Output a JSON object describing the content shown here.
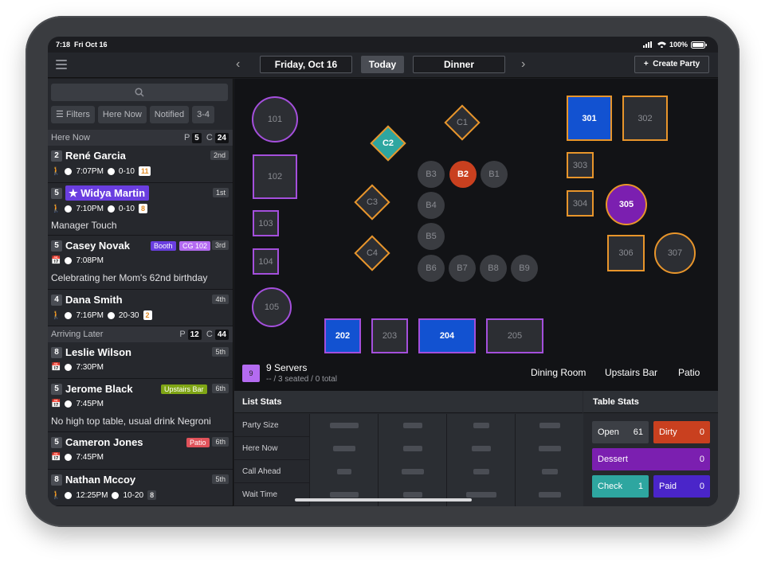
{
  "status_bar": {
    "time": "7:18",
    "date": "Fri Oct 16",
    "battery": "100%"
  },
  "topbar": {
    "date": "Friday, Oct 16",
    "today": "Today",
    "shift": "Dinner",
    "create": "Create Party"
  },
  "sidebar": {
    "chips": [
      "Filters",
      "Here Now",
      "Notified",
      "3-4"
    ],
    "here_now": {
      "label": "Here Now",
      "p_label": "P",
      "p": "5",
      "c_label": "C",
      "c": "24"
    },
    "arriving_later": {
      "label": "Arriving Later",
      "p_label": "P",
      "p": "12",
      "c_label": "C",
      "c": "44"
    },
    "parties": [
      {
        "size": "2",
        "name": "René Garcia",
        "rank": "2nd",
        "time": "7:07PM",
        "wait": "0-10",
        "wait_num": "11"
      },
      {
        "size": "5",
        "name": "Widya Martin",
        "rank": "1st",
        "time": "7:10PM",
        "wait": "0-10",
        "wait_num": "8",
        "note": "Manager Touch"
      },
      {
        "size": "5",
        "name": "Casey Novak",
        "rank": "3rd",
        "tag1": "Booth",
        "tag2": "CG 102",
        "time": "7:08PM",
        "note": "Celebrating her Mom's 62nd birthday"
      },
      {
        "size": "4",
        "name": "Dana Smith",
        "rank": "4th",
        "time": "7:16PM",
        "wait": "20-30",
        "wait_num": "2"
      },
      {
        "size": "8",
        "name": "Leslie Wilson",
        "rank": "5th",
        "time": "7:30PM"
      },
      {
        "size": "5",
        "name": "Jerome Black",
        "rank": "6th",
        "tag1": "Upstairs Bar",
        "time": "7:45PM",
        "note": "No high top table, usual drink Negroni"
      },
      {
        "size": "5",
        "name": "Cameron Jones",
        "rank": "6th",
        "tag1": "Patio",
        "time": "7:45PM"
      },
      {
        "size": "8",
        "name": "Nathan Mccoy",
        "rank": "5th",
        "time": "12:25PM",
        "wait": "10-20",
        "wait_num": "8"
      }
    ]
  },
  "floor": {
    "tables": {
      "t101": "101",
      "t102": "102",
      "t103": "103",
      "t104": "104",
      "t105": "105",
      "c1": "C1",
      "c2": "C2",
      "c3": "C3",
      "c4": "C4",
      "b1": "B1",
      "b2": "B2",
      "b3": "B3",
      "b4": "B4",
      "b5": "B5",
      "b6": "B6",
      "b7": "B7",
      "b8": "B8",
      "b9": "B9",
      "t202": "202",
      "t203": "203",
      "t204": "204",
      "t205": "205",
      "t301": "301",
      "t302": "302",
      "t303": "303",
      "t304": "304",
      "t305": "305",
      "t306": "306",
      "t307": "307"
    },
    "servers": {
      "badge": "9",
      "title": "9 Servers",
      "subtitle": "-- / 3 seated / 0 total"
    },
    "rooms": [
      "Dining Room",
      "Upstairs Bar",
      "Patio"
    ]
  },
  "list_stats": {
    "title": "List Stats",
    "rows": [
      "Party Size",
      "Here Now",
      "Call Ahead",
      "Wait Time"
    ]
  },
  "table_stats": {
    "title": "Table Stats",
    "open": {
      "label": "Open",
      "value": "61"
    },
    "dirty": {
      "label": "Dirty",
      "value": "0"
    },
    "dessert": {
      "label": "Dessert",
      "value": "0"
    },
    "check": {
      "label": "Check",
      "value": "1"
    },
    "paid": {
      "label": "Paid",
      "value": "0"
    }
  },
  "colors": {
    "purple": "#a44fdc",
    "orange": "#e8952b",
    "blue": "#1252d1",
    "teal": "#2ea6a0",
    "red": "#c9401f"
  }
}
